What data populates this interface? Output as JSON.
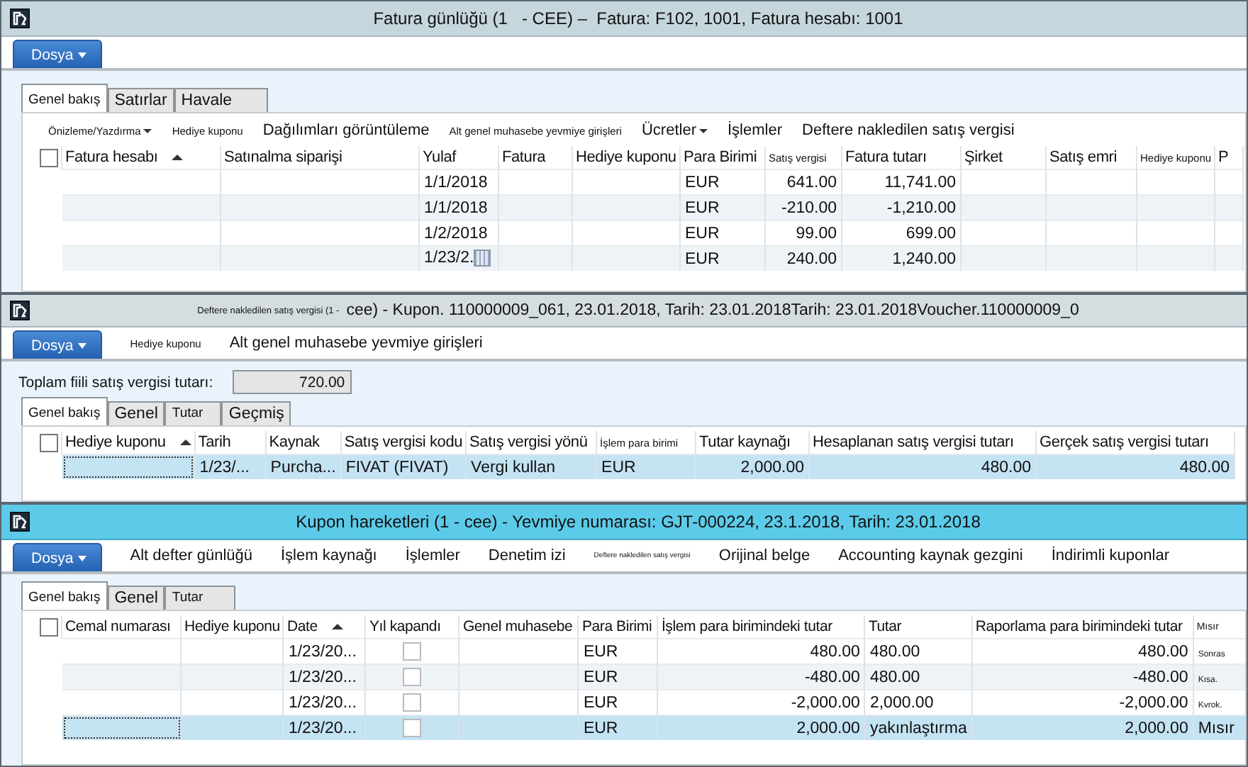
{
  "windows": [
    {
      "active": false,
      "title_parts": [
        {
          "text": "Fatura günlüğü (1   - CEE) –  Fatura: F102, 1001, Fatura hesabı: 1001",
          "kind": "normal"
        }
      ],
      "ribbon": {
        "file_button": "Dosya"
      },
      "tabs": [
        {
          "label": "Genel bakış",
          "selected": true,
          "kind": "small"
        },
        {
          "label": "Satırlar",
          "selected": false,
          "kind": "normal"
        },
        {
          "label": "Havale",
          "selected": false,
          "kind": "normal"
        }
      ],
      "action_bar": [
        {
          "label": "Önizleme/Yazdırma",
          "kind": "small",
          "dropdown": true
        },
        {
          "label": "Hediye kuponu",
          "kind": "small"
        },
        {
          "label": "Dağılımları görüntüleme",
          "kind": "normal"
        },
        {
          "label": "Alt genel muhasebe yevmiye girişleri",
          "kind": "small"
        },
        {
          "label": "Ücretler",
          "kind": "normal",
          "dropdown": true
        },
        {
          "label": "İşlemler",
          "kind": "normal"
        },
        {
          "label": "Deftere nakledilen satış vergisi",
          "kind": "normal"
        }
      ],
      "table": {
        "select_all_checked": false,
        "columns": [
          {
            "label": "Fatura hesabı",
            "sorted": true
          },
          {
            "label": "Satınalma siparişi"
          },
          {
            "label": "Yulaf"
          },
          {
            "label": "Fatura"
          },
          {
            "label": "Hediye kuponu"
          },
          {
            "label": "Para Birimi"
          },
          {
            "label": "Satış vergisi",
            "small": true
          },
          {
            "label": "Fatura tutarı"
          },
          {
            "label": "Şirket"
          },
          {
            "label": "Satış emri"
          },
          {
            "label": "Hediye kuponu",
            "small": true
          },
          {
            "label": "P"
          }
        ],
        "rows": [
          {
            "selected": false,
            "cells": [
              null,
              null,
              "1/1/2018",
              null,
              null,
              "EUR",
              "641.00",
              "11,741.00",
              null,
              null,
              null,
              null
            ]
          },
          {
            "selected": false,
            "cells": [
              null,
              null,
              "1/1/2018",
              null,
              null,
              "EUR",
              "-210.00",
              "-1,210.00",
              null,
              null,
              null,
              null
            ]
          },
          {
            "selected": false,
            "cells": [
              null,
              null,
              "1/2/2018",
              null,
              null,
              "EUR",
              "99.00",
              "699.00",
              null,
              null,
              null,
              null
            ]
          },
          {
            "selected": false,
            "cells": [
              null,
              null,
              {
                "kind": "date_picker",
                "text": "1/23/2."
              },
              null,
              null,
              "EUR",
              "240.00",
              "1,240.00",
              null,
              null,
              null,
              null
            ]
          }
        ]
      }
    },
    {
      "active": false,
      "title_parts": [
        {
          "text": "Deftere nakledilen satış vergisi (1 -",
          "kind": "small"
        },
        {
          "text": "cee) - Kupon. 110000009_061, 23.01.2018, Tarih: 23.01.2018Tarih: 23.01.2018Voucher.110000009_0",
          "kind": "normal"
        }
      ],
      "ribbon": {
        "file_button": "Dosya",
        "items": [
          {
            "label": "Hediye kuponu",
            "kind": "small"
          },
          {
            "label": "Alt genel muhasebe yevmiye girişleri",
            "kind": "normal"
          }
        ]
      },
      "summary": {
        "label": "Toplam fiili satış vergisi tutarı:",
        "value": "720.00"
      },
      "tabs": [
        {
          "label": "Genel bakış",
          "selected": true,
          "kind": "small"
        },
        {
          "label": "Genel",
          "selected": false,
          "kind": "normal"
        },
        {
          "label": "Tutar",
          "selected": false,
          "kind": "small"
        },
        {
          "label": "Geçmiş",
          "selected": false,
          "kind": "normal"
        }
      ],
      "table": {
        "select_all_checked": false,
        "columns": [
          {
            "label": "Hediye kuponu",
            "sorted": true
          },
          {
            "label": "Tarih"
          },
          {
            "label": "Kaynak"
          },
          {
            "label": "Satış vergisi kodu"
          },
          {
            "label": "Satış vergisi yönü"
          },
          {
            "label": "İşlem para birimi",
            "small": true
          },
          {
            "label": "Tutar kaynağı"
          },
          {
            "label": "Hesaplanan satış vergisi tutarı"
          },
          {
            "label": "Gerçek satış vergisi tutarı"
          }
        ],
        "rows": [
          {
            "selected": true,
            "cells": [
              null,
              "1/23/...",
              "Purcha...",
              "FIVAT (FIVAT)",
              "Vergi kullan",
              "EUR",
              "2,000.00",
              "480.00",
              "480.00"
            ]
          }
        ]
      }
    },
    {
      "active": true,
      "title_parts": [
        {
          "text": "Kupon hareketleri (1 - cee) - Yevmiye numarası: GJT-000224, 23.1.2018, Tarih: 23.01.2018",
          "kind": "normal"
        }
      ],
      "ribbon": {
        "file_button": "Dosya",
        "items": [
          {
            "label": "Alt defter günlüğü",
            "kind": "normal"
          },
          {
            "label": "İşlem kaynağı",
            "kind": "normal"
          },
          {
            "label": "İşlemler",
            "kind": "normal"
          },
          {
            "label": "Denetim izi",
            "kind": "normal"
          },
          {
            "label": "Deftere nakledilen satış vergisi",
            "kind": "tiny"
          },
          {
            "label": "Orijinal belge",
            "kind": "normal"
          },
          {
            "label": "Accounting kaynak gezgini",
            "kind": "normal"
          },
          {
            "label": "İndirimli kuponlar",
            "kind": "normal"
          }
        ]
      },
      "tabs": [
        {
          "label": "Genel bakış",
          "selected": true,
          "kind": "small"
        },
        {
          "label": "Genel",
          "selected": false,
          "kind": "normal"
        },
        {
          "label": "Tutar",
          "selected": false,
          "kind": "small"
        }
      ],
      "table": {
        "select_all_checked": false,
        "columns": [
          {
            "label": "Cemal numarası"
          },
          {
            "label": "Hediye kuponu"
          },
          {
            "label": "Date",
            "sorted": true
          },
          {
            "label": "Yıl kapandı"
          },
          {
            "label": "Genel muhasebe"
          },
          {
            "label": "Para Birimi"
          },
          {
            "label": "İşlem para birimindeki tutar"
          },
          {
            "label": "Tutar"
          },
          {
            "label": "Raporlama para birimindeki tutar"
          },
          {
            "label": "Mısır",
            "small": true
          }
        ],
        "rows": [
          {
            "selected": false,
            "cells": [
              null,
              null,
              "1/23/20...",
              {
                "kind": "checkbox",
                "checked": false
              },
              null,
              "EUR",
              "480.00",
              "480.00",
              "480.00",
              {
                "kind": "tiny",
                "text": "Sonras"
              }
            ]
          },
          {
            "selected": false,
            "cells": [
              null,
              null,
              "1/23/20...",
              {
                "kind": "checkbox",
                "checked": false
              },
              null,
              "EUR",
              "-480.00",
              "480.00",
              "-480.00",
              {
                "kind": "tiny",
                "text": "Kısa."
              }
            ]
          },
          {
            "selected": false,
            "cells": [
              null,
              null,
              "1/23/20...",
              {
                "kind": "checkbox",
                "checked": false
              },
              null,
              "EUR",
              "-2,000.00",
              "2,000.00",
              "-2,000.00",
              {
                "kind": "tiny",
                "text": "Kvrok."
              }
            ]
          },
          {
            "selected": true,
            "cells": [
              null,
              null,
              "1/23/20...",
              {
                "kind": "checkbox",
                "checked": false
              },
              null,
              "EUR",
              "2,000.00",
              "yakınlaştırma",
              "2,000.00",
              "Mısır"
            ]
          }
        ]
      }
    }
  ]
}
